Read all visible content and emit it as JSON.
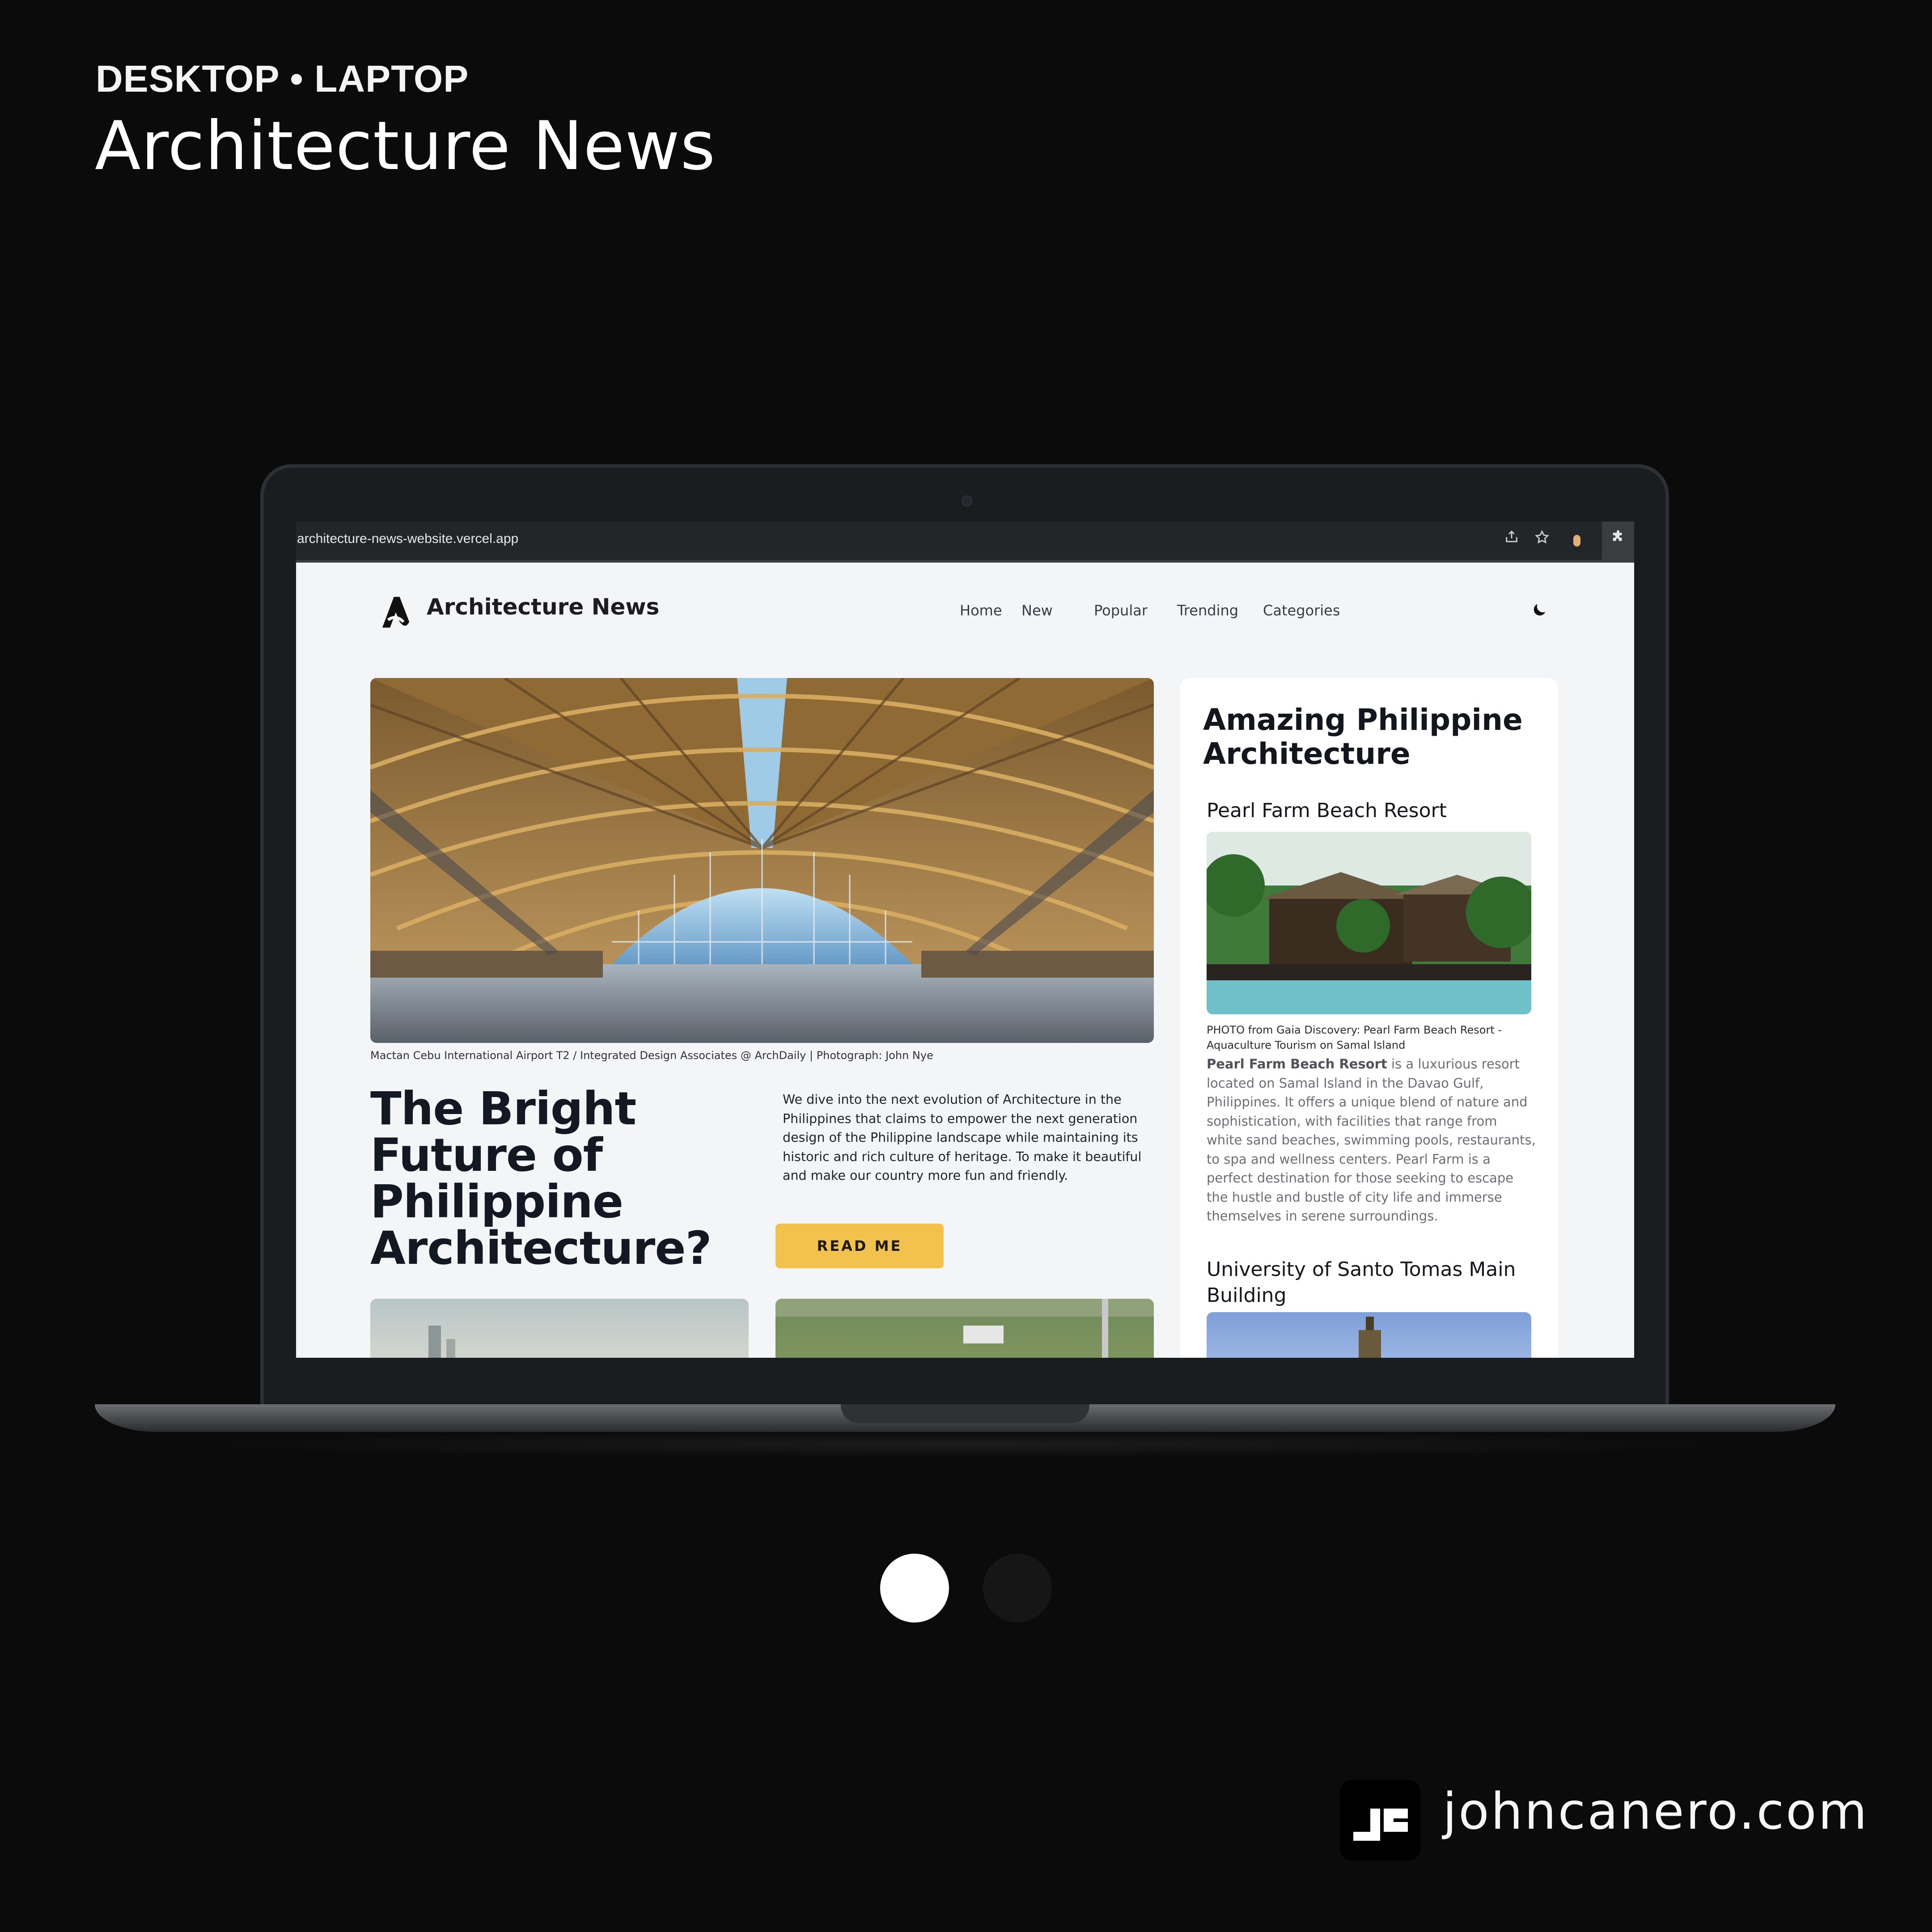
{
  "showcase": {
    "eyebrow": "DESKTOP • LAPTOP",
    "title": "Architecture News",
    "footer_domain": "johncanero.com",
    "pager": {
      "count": 2,
      "active": 1
    }
  },
  "browser": {
    "url": "architecture-news-website.vercel.app",
    "icons": [
      "share-icon",
      "star-icon",
      "extension-badge-icon",
      "puzzle-icon"
    ]
  },
  "site": {
    "brand": "Architecture News",
    "nav": [
      "Home",
      "New",
      "Popular",
      "Trending",
      "Categories"
    ],
    "theme_toggle_icon": "moon-icon",
    "hero": {
      "caption": "Mactan Cebu International Airport T2 / Integrated Design Associates @ ArchDaily | Photograph: John Nye",
      "headline": "The Bright Future of Philippine Architecture?",
      "lede": "We dive into the next evolution of Architecture in the Philippines that claims to empower the next generation design of the Philippine landscape while maintaining its historic and rich culture of heritage. To make it beautiful and make our country more fun and friendly.",
      "cta": "READ ME"
    },
    "sidebar": {
      "title": "Amazing Philippine Architecture",
      "item1": {
        "heading": "Pearl Farm Beach Resort",
        "caption": "PHOTO from Gaia Discovery: Pearl Farm Beach Resort - Aquaculture Tourism on Samal Island",
        "body_strong": "Pearl Farm Beach Resort",
        "body": " is a luxurious resort located on Samal Island in the Davao Gulf, Philippines. It offers a unique blend of nature and sophistication, with facilities that range from white sand beaches, swimming pools, restaurants, to spa and wellness centers. Pearl Farm is a perfect destination for those seeking to escape the hustle and bustle of city life and immerse themselves in serene surroundings."
      },
      "item2": {
        "heading": "University of Santo Tomas Main Building"
      }
    }
  },
  "colors": {
    "background": "#0b0b0b",
    "page_bg": "#f4f5f7",
    "cta": "#f2c14e",
    "text_dark": "#141823"
  }
}
